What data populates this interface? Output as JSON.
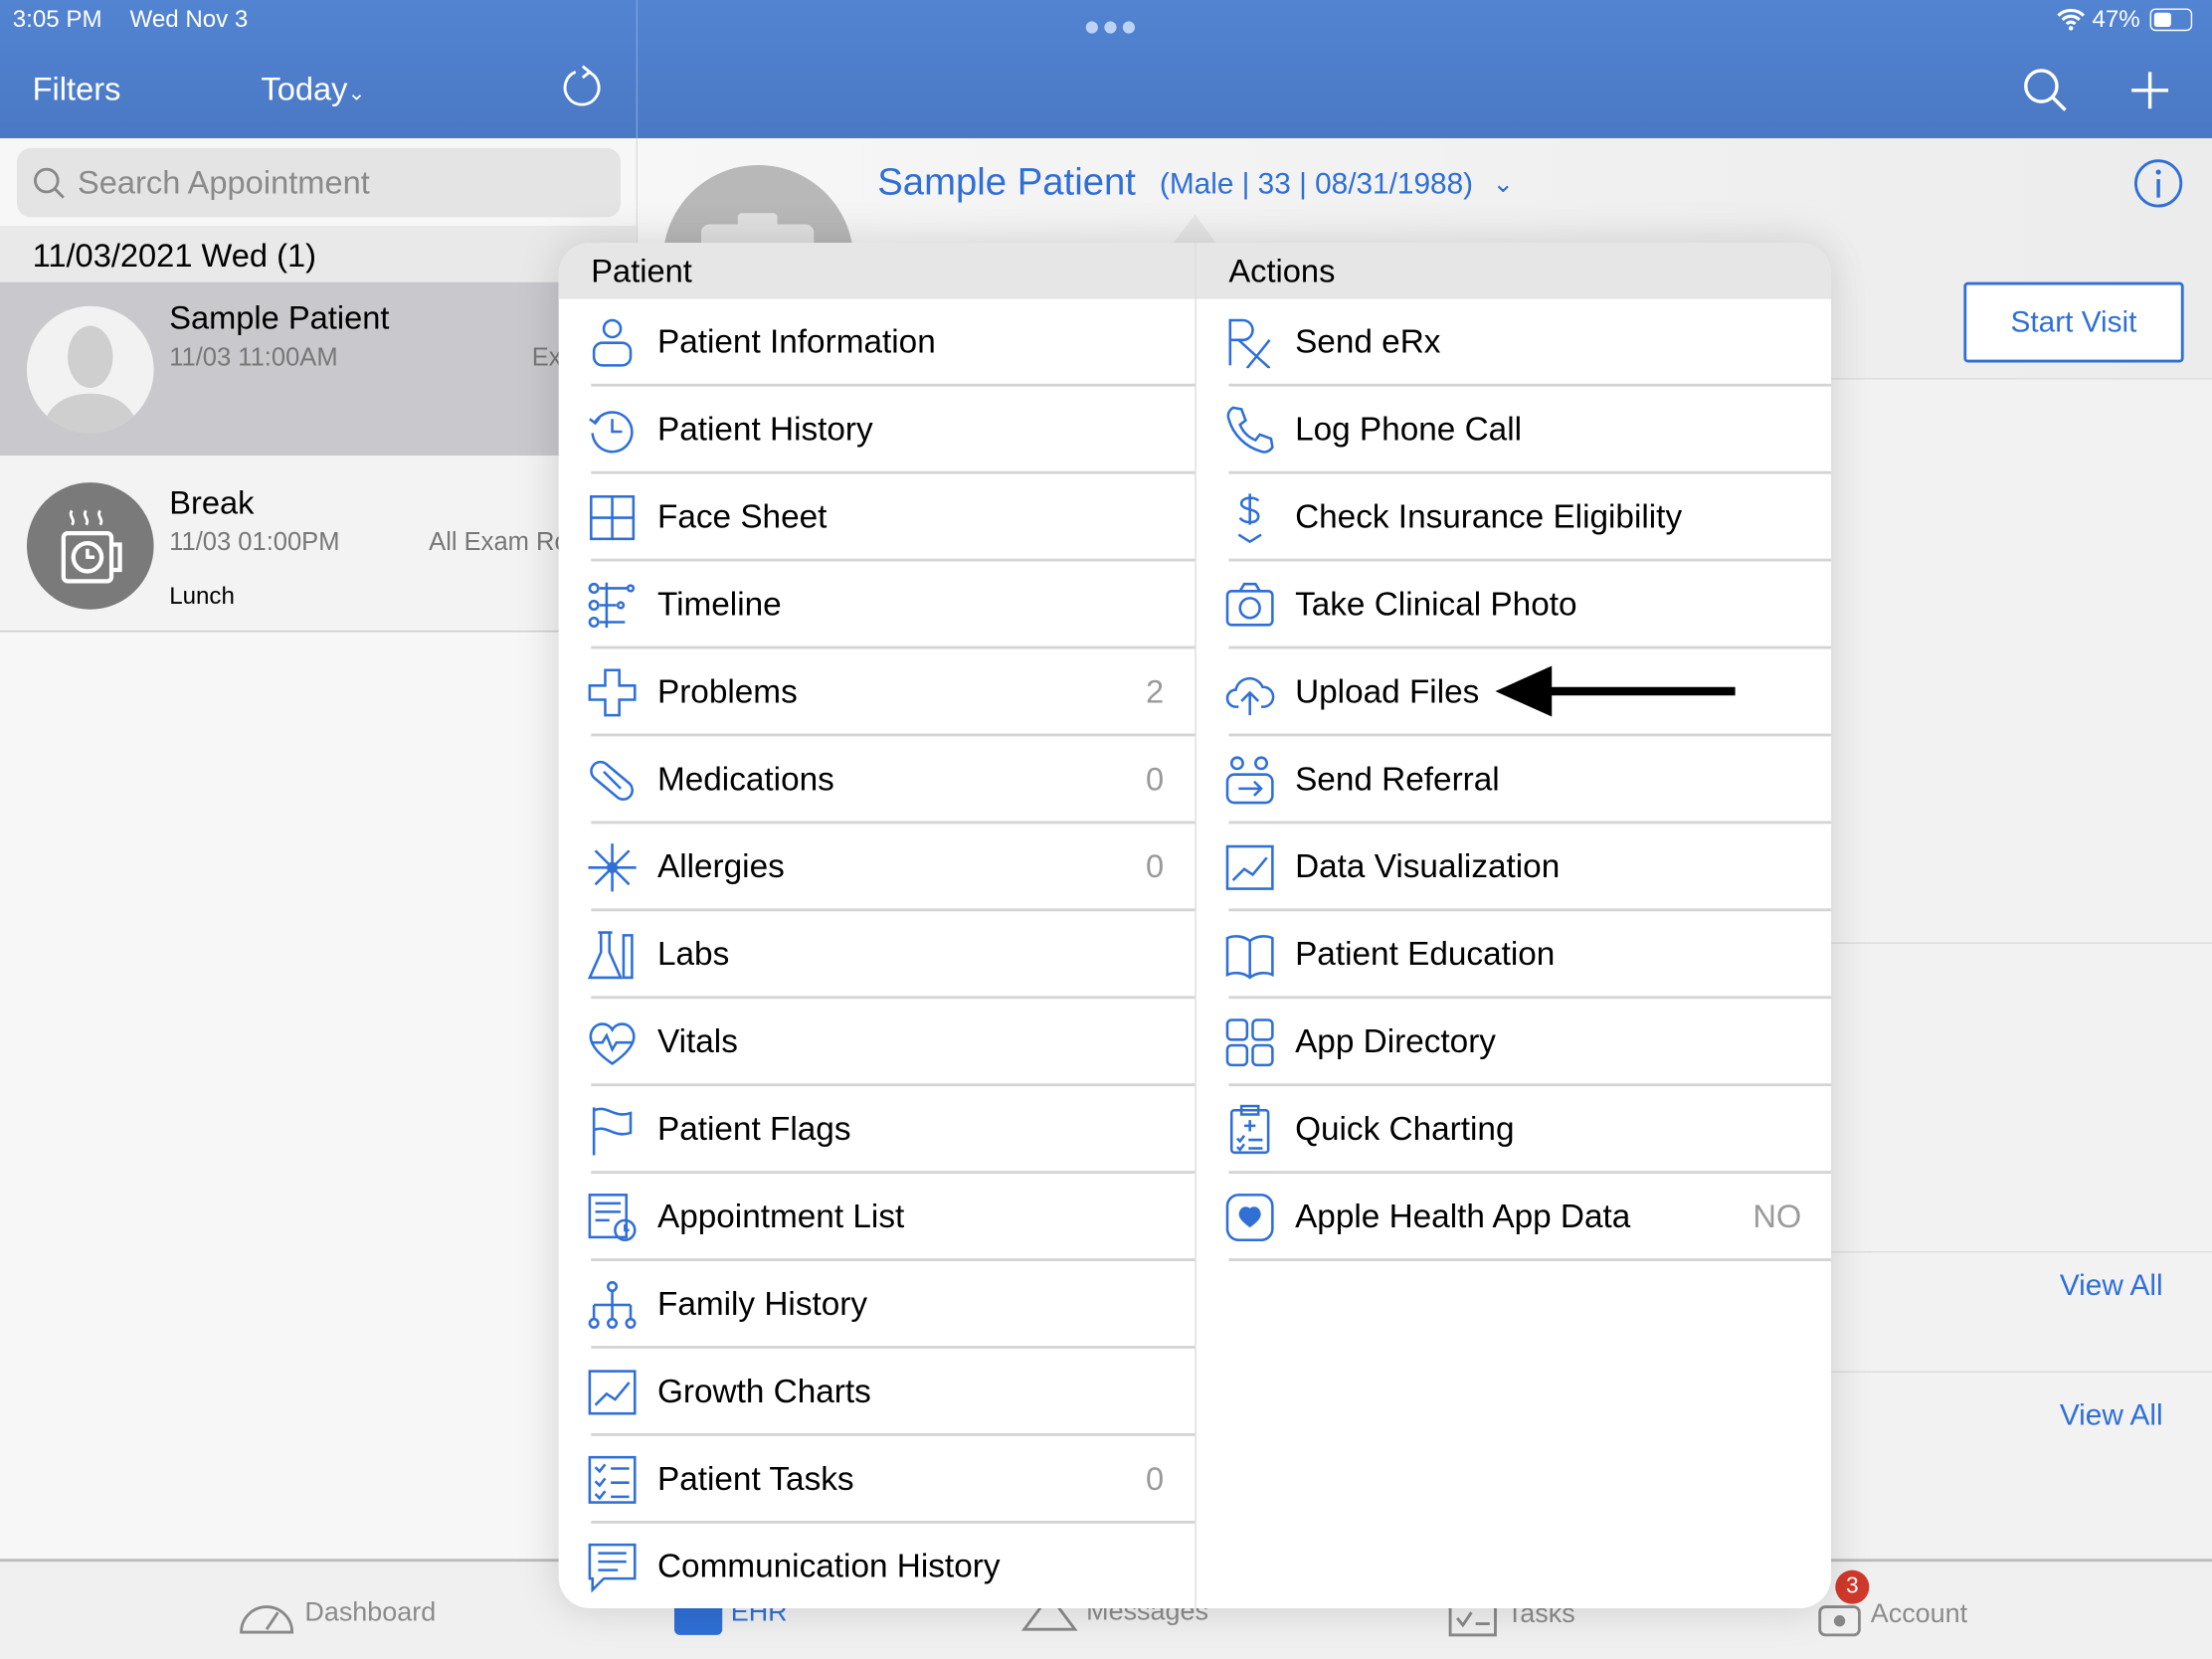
{
  "status_bar": {
    "time": "3:05 PM",
    "date": "Wed Nov 3",
    "battery": "47%"
  },
  "nav": {
    "filters": "Filters",
    "today": "Today"
  },
  "left": {
    "search_placeholder": "Search Appointment",
    "date_header": "11/03/2021 Wed (1)",
    "appointments": [
      {
        "name": "Sample Patient",
        "time": "11/03 11:00AM",
        "extra": "Ex"
      },
      {
        "name": "Break",
        "time": "11/03 01:00PM",
        "extra": "All Exam Ro",
        "note": "Lunch"
      }
    ]
  },
  "patient": {
    "name": "Sample Patient",
    "details": "(Male | 33 | 08/31/1988)"
  },
  "buttons": {
    "start_visit": "Start Visit",
    "view_all_1": "View All",
    "view_all_2": "View All"
  },
  "menu": {
    "patient_header": "Patient",
    "actions_header": "Actions",
    "patient_items": [
      {
        "label": "Patient Information",
        "icon": "person-icon"
      },
      {
        "label": "Patient History",
        "icon": "history-icon"
      },
      {
        "label": "Face Sheet",
        "icon": "grid-icon"
      },
      {
        "label": "Timeline",
        "icon": "timeline-icon"
      },
      {
        "label": "Problems",
        "icon": "cross-icon",
        "count": "2"
      },
      {
        "label": "Medications",
        "icon": "pill-icon",
        "count": "0"
      },
      {
        "label": "Allergies",
        "icon": "allergy-icon",
        "count": "0"
      },
      {
        "label": "Labs",
        "icon": "flask-icon"
      },
      {
        "label": "Vitals",
        "icon": "heart-pulse-icon"
      },
      {
        "label": "Patient Flags",
        "icon": "flag-icon"
      },
      {
        "label": "Appointment List",
        "icon": "appointment-list-icon"
      },
      {
        "label": "Family History",
        "icon": "family-tree-icon"
      },
      {
        "label": "Growth Charts",
        "icon": "chart-icon"
      },
      {
        "label": "Patient Tasks",
        "icon": "checklist-icon",
        "count": "0"
      },
      {
        "label": "Communication History",
        "icon": "chat-list-icon"
      }
    ],
    "action_items": [
      {
        "label": "Send eRx",
        "icon": "rx-icon"
      },
      {
        "label": "Log Phone Call",
        "icon": "phone-icon"
      },
      {
        "label": "Check Insurance Eligibility",
        "icon": "dollar-icon"
      },
      {
        "label": "Take Clinical Photo",
        "icon": "camera-icon"
      },
      {
        "label": "Upload Files",
        "icon": "cloud-upload-icon"
      },
      {
        "label": "Send Referral",
        "icon": "referral-icon"
      },
      {
        "label": "Data Visualization",
        "icon": "chart-icon"
      },
      {
        "label": "Patient Education",
        "icon": "book-icon"
      },
      {
        "label": "App Directory",
        "icon": "apps-icon"
      },
      {
        "label": "Quick Charting",
        "icon": "clipboard-icon"
      },
      {
        "label": "Apple Health App Data",
        "icon": "health-heart-icon",
        "count": "NO"
      }
    ]
  },
  "tabs": [
    {
      "label": "Dashboard"
    },
    {
      "label": "EHR",
      "active": true
    },
    {
      "label": "Messages"
    },
    {
      "label": "Tasks"
    },
    {
      "label": "Account",
      "badge": "3"
    }
  ],
  "colors": {
    "accent": "#2f6fd6",
    "nav": "#4e7fcf",
    "badge": "#d0392b"
  }
}
